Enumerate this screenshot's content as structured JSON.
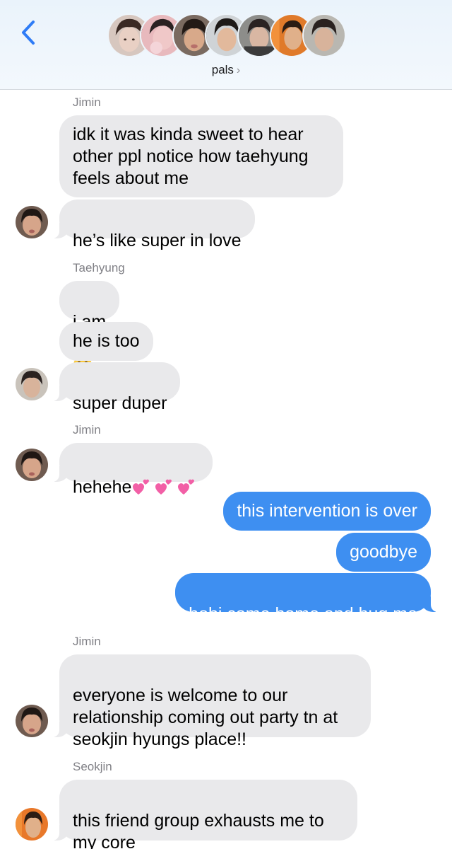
{
  "header": {
    "group_name": "pals",
    "chevron": "›",
    "member_avatars": [
      {
        "name": "avatar-1",
        "skin": "#e9d0c4",
        "hair": "#3b2a24",
        "bg": "#d7c7bf"
      },
      {
        "name": "avatar-2",
        "skin": "#f0c8c8",
        "hair": "#2b2222",
        "bg": "#e8b9bd"
      },
      {
        "name": "avatar-3",
        "skin": "#d8a98a",
        "hair": "#231a16",
        "bg": "#7a6a60"
      },
      {
        "name": "avatar-4",
        "skin": "#e2b99c",
        "hair": "#1e1a18",
        "bg": "#cfd3d6"
      },
      {
        "name": "avatar-5",
        "skin": "#d9b7a3",
        "hair": "#2a2322",
        "bg": "#8d8d8a"
      },
      {
        "name": "avatar-6",
        "skin": "#e0b08a",
        "hair": "#2a1c14",
        "bg": "#e07a2a"
      },
      {
        "name": "avatar-7",
        "skin": "#d8b39b",
        "hair": "#2a2220",
        "bg": "#b9b7b1"
      }
    ]
  },
  "messages": {
    "s1": "Jimin",
    "m1": "idk it was kinda sweet to hear\nother ppl notice how taehyung\nfeels about me",
    "m2": "he’s like super in love",
    "s2": "Taehyung",
    "m3": "i am",
    "m4": "he is too",
    "m5": "super duper",
    "s3": "Jimin",
    "m6": "hehehe",
    "m7": "this intervention is over",
    "m8": "goodbye",
    "m9": "hobi come home and hug me",
    "s4": "Jimin",
    "m10": "everyone is welcome to our\nrelationship coming out party tn at\nseokjin hyungs place!!",
    "s5": "Seokjin",
    "m11": "this friend group exhausts me to\nmy core"
  },
  "emojis": {
    "m3_emoji": "face-savoring-food-emoji",
    "m6_emoji": "two-hearts-emoji x3"
  },
  "colors": {
    "incoming_bubble": "#e9e9eb",
    "outgoing_bubble": "#3e8ff1",
    "back_chevron": "#2f7cf6",
    "sender_label": "#808086",
    "header_bg": "#eaf3fb"
  }
}
